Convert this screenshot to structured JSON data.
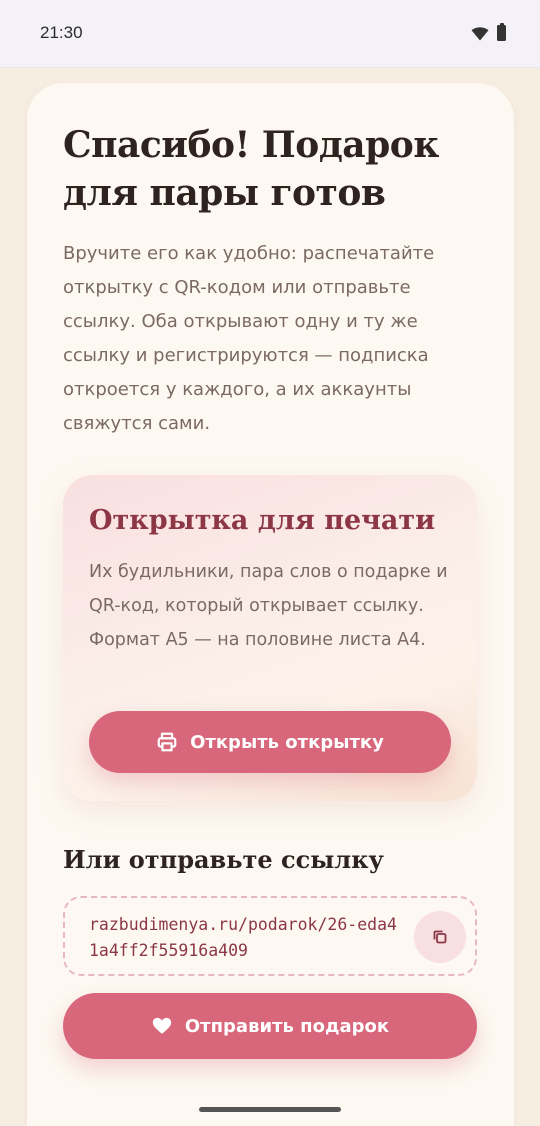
{
  "status_bar": {
    "time": "21:30"
  },
  "page": {
    "title": "Спасибо! Подарок для пары готов",
    "intro": "Вручите его как удобно: распечатайте открытку с QR-кодом или отправьте ссылку. Оба открывают одну и ту же ссылку и регистрируются — подписка откроется у каждого, а их аккаунты свяжутся сами."
  },
  "print_card": {
    "title": "Открытка для печати",
    "description": "Их будильники, пара слов о подарке и QR-код, который открывает ссылку. Формат A5 — на половине листа A4.",
    "button_label": "Открыть открытку",
    "button_icon": "printer-icon"
  },
  "send_section": {
    "title": "Или отправьте ссылку",
    "link": "razbudimenya.ru/podarok/26-eda41a4ff2f55916a409",
    "copy_icon": "copy-icon",
    "button_label": "Отправить подарок",
    "button_icon": "heart-icon"
  },
  "colors": {
    "accent": "#d9677b",
    "accent_dark": "#8c3646",
    "background": "#f7eee2",
    "card": "#fdf9f2"
  }
}
